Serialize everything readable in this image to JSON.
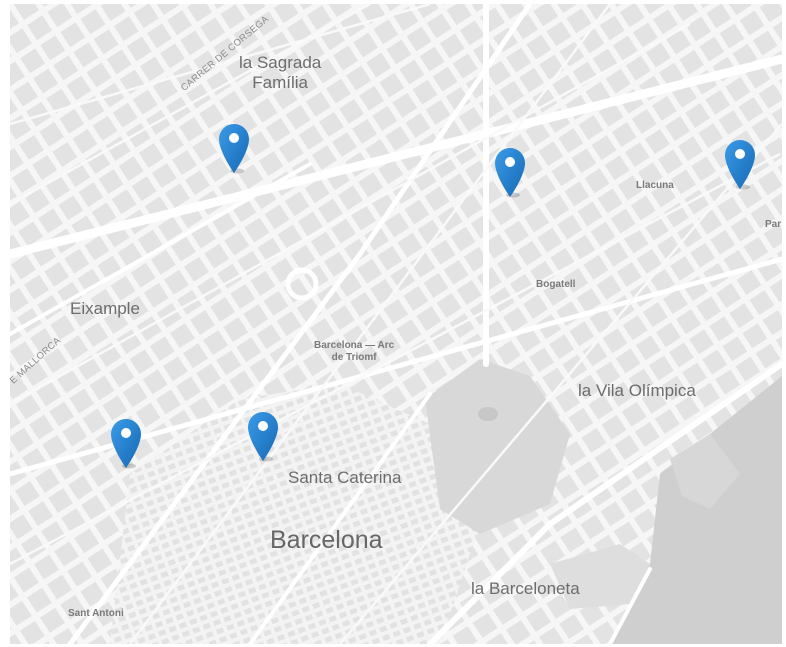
{
  "map": {
    "labels": {
      "sagrada_familia": "la Sagrada\nFamília",
      "carrer_corsega": "CARRER DE CORSEGA",
      "llacuna": "Llacuna",
      "par": "Par",
      "bogatell": "Bogatell",
      "eixample": "Eixample",
      "mallorca": "E MALLORCA",
      "arc_de_triomf": "Barcelona — Arc\nde Triomf",
      "vila_olimpica": "la Vila Olímpica",
      "santa_caterina": "Santa Caterina",
      "barcelona": "Barcelona",
      "barceloneta": "la Barceloneta",
      "sant_antoni": "Sant Antoni"
    },
    "pin_color": "#1f7fcf",
    "pin_count": 5
  }
}
